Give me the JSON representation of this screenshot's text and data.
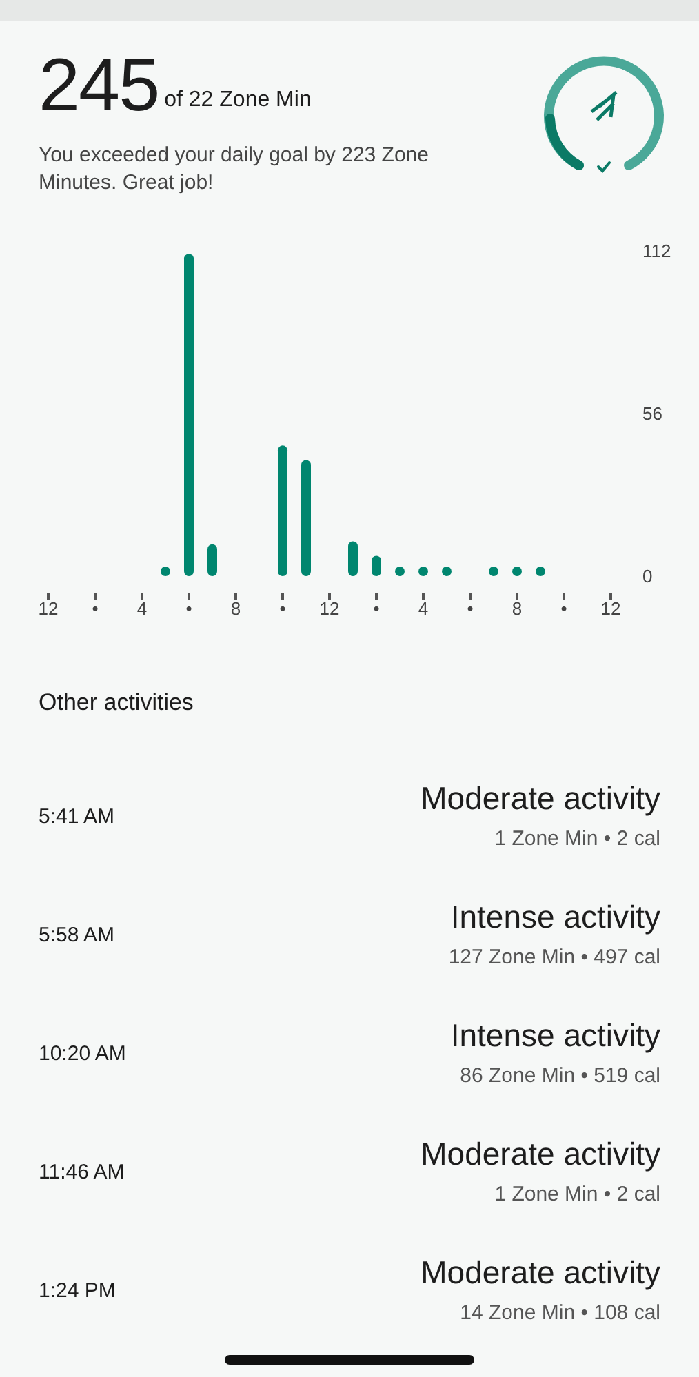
{
  "summary": {
    "value": "245",
    "unit": "of 22 Zone Min",
    "message": "You exceeded your daily goal by 223 Zone Minutes. Great job!"
  },
  "chart": {
    "chart_data": {
      "type": "bar",
      "categories": [
        "12",
        null,
        "•",
        null,
        "4",
        null,
        "•",
        null,
        "8",
        null,
        "•",
        null,
        "12",
        null,
        "•",
        null,
        "4",
        null,
        "•",
        null,
        "8",
        null,
        "•",
        null,
        "12"
      ],
      "series": [
        {
          "color": "#00866f",
          "values": [
            null,
            null,
            null,
            null,
            null,
            3.3,
            111,
            11,
            null,
            null,
            45,
            40,
            null,
            12,
            7,
            3.3,
            3.3,
            3.3,
            null,
            3.3,
            3.3,
            3.3,
            null,
            null,
            null
          ]
        }
      ],
      "ylim": [
        0,
        112
      ],
      "yticks": [
        0,
        56,
        112
      ]
    }
  },
  "activities_title": "Other activities",
  "activities": [
    {
      "time": "5:41 AM",
      "name": "Moderate activity",
      "details": "1 Zone Min • 2 cal"
    },
    {
      "time": "5:58 AM",
      "name": "Intense activity",
      "details": "127 Zone Min • 497 cal"
    },
    {
      "time": "10:20 AM",
      "name": "Intense activity",
      "details": "86 Zone Min • 519 cal"
    },
    {
      "time": "11:46 AM",
      "name": "Moderate activity",
      "details": "1 Zone Min • 2 cal"
    },
    {
      "time": "1:24 PM",
      "name": "Moderate activity",
      "details": "14 Zone Min • 108 cal"
    }
  ]
}
